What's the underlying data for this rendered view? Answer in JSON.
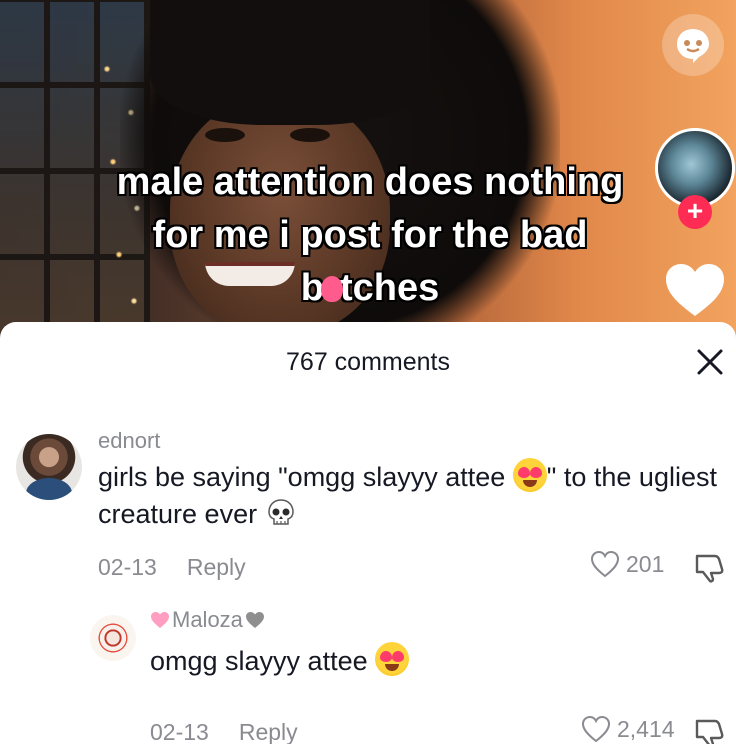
{
  "video": {
    "caption_lines": [
      "male attention does nothing",
      "for me i post for the bad",
      "b",
      "tches"
    ],
    "follow_symbol": "+"
  },
  "comments_sheet": {
    "title": "767 comments",
    "close_symbol": "✕"
  },
  "comments": [
    {
      "username": "ednort",
      "text_part1": "girls be saying \"omgg slayyy attee ",
      "text_part2": "\" to the ugliest creature ever ",
      "date": "02-13",
      "reply_label": "Reply",
      "likes": "201"
    },
    {
      "username": "Maloza",
      "text": "omgg slayyy attee ",
      "date": "02-13",
      "reply_label": "Reply",
      "likes": "2,414"
    }
  ],
  "colors": {
    "accent": "#fe2c55",
    "muted_text": "#8a8b91",
    "primary_text": "#161823"
  },
  "icons": {
    "top_right": "chat-face-icon",
    "like": "heart-icon",
    "dislike": "thumbs-down-icon",
    "close": "close-icon"
  }
}
